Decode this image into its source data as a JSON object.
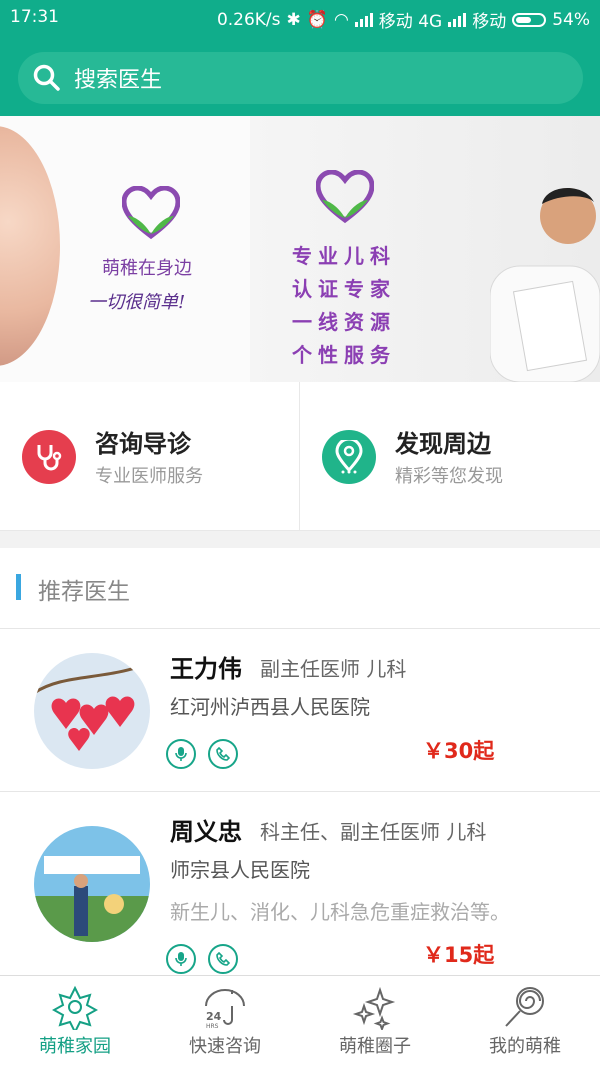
{
  "status_bar": {
    "time": "17:31",
    "speed": "0.26K/s",
    "carrier1": "移动 4G",
    "carrier2": "移动",
    "battery": "54%"
  },
  "search": {
    "placeholder": "搜索医生"
  },
  "banner": {
    "slogan_line1": "萌稚在身边",
    "slogan_line2": "一切很简单!",
    "promo_lines": [
      "专业儿科",
      "认证专家",
      "一线资源",
      "个性服务"
    ]
  },
  "features": [
    {
      "title": "咨询导诊",
      "subtitle": "专业医师服务",
      "icon": "stethoscope-icon",
      "color": "#e53e4e"
    },
    {
      "title": "发现周边",
      "subtitle": "精彩等您发现",
      "icon": "location-pin-icon",
      "color": "#20b48a"
    }
  ],
  "section_title": "推荐医生",
  "doctors": [
    {
      "name": "王力伟",
      "title": "副主任医师 儿科",
      "hospital": "红河州泸西县人民医院",
      "specialty": "",
      "price": "￥30起"
    },
    {
      "name": "周义忠",
      "title": "科主任、副主任医师 儿科",
      "hospital": "师宗县人民医院",
      "specialty": "新生儿、消化、儿科急危重症救治等。",
      "price": "￥15起"
    }
  ],
  "nav": [
    {
      "label": "萌稚家园",
      "icon": "flower-icon",
      "active": true
    },
    {
      "label": "快速咨询",
      "icon": "24hrs-umbrella-icon",
      "active": false
    },
    {
      "label": "萌稚圈子",
      "icon": "sparkles-icon",
      "active": false
    },
    {
      "label": "我的萌稚",
      "icon": "lollipop-icon",
      "active": false
    }
  ],
  "colors": {
    "primary": "#10ad8b",
    "price": "#e0291b"
  }
}
